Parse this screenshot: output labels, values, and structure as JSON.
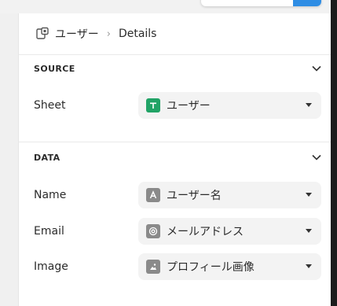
{
  "breadcrumb": {
    "parent": "ユーザー",
    "separator": "›",
    "current": "Details"
  },
  "source": {
    "title": "SOURCE",
    "sheet": {
      "label": "Sheet",
      "value": "ユーザー"
    }
  },
  "data": {
    "title": "DATA",
    "fields": [
      {
        "label": "Name",
        "value": "ユーザー名",
        "icon": "text-type-icon"
      },
      {
        "label": "Email",
        "value": "メールアドレス",
        "icon": "at-icon"
      },
      {
        "label": "Image",
        "value": "プロフィール画像",
        "icon": "image-icon"
      }
    ]
  },
  "colors": {
    "sheet_icon": "#21a366",
    "field_icon": "#8a8a8a",
    "accent": "#2f8de4"
  }
}
